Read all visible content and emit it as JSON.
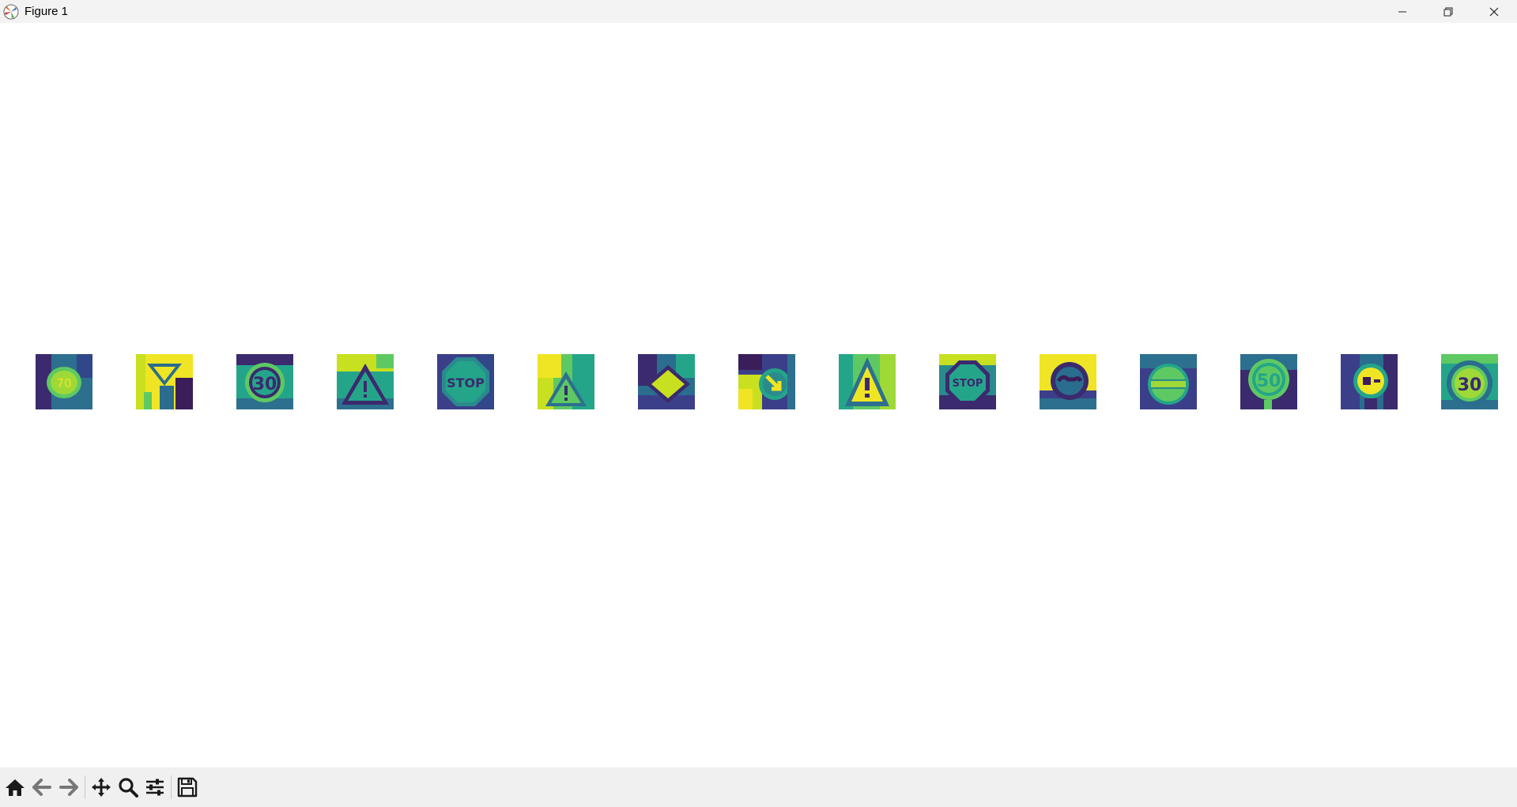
{
  "window": {
    "title": "Figure 1",
    "controls": [
      "minimize",
      "maximize",
      "close"
    ]
  },
  "figure": {
    "colormap": "viridis",
    "images": [
      {
        "index": 1,
        "depicts": "speed-limit-70",
        "text": "70"
      },
      {
        "index": 2,
        "depicts": "yield",
        "text": ""
      },
      {
        "index": 3,
        "depicts": "speed-limit-30",
        "text": "30"
      },
      {
        "index": 4,
        "depicts": "general-caution",
        "text": ""
      },
      {
        "index": 5,
        "depicts": "stop",
        "text": "STOP"
      },
      {
        "index": 6,
        "depicts": "general-caution",
        "text": ""
      },
      {
        "index": 7,
        "depicts": "priority-road",
        "text": ""
      },
      {
        "index": 8,
        "depicts": "keep-right",
        "text": ""
      },
      {
        "index": 9,
        "depicts": "general-caution",
        "text": ""
      },
      {
        "index": 10,
        "depicts": "stop",
        "text": "STOP"
      },
      {
        "index": 11,
        "depicts": "no-passing",
        "text": ""
      },
      {
        "index": 12,
        "depicts": "no-entry",
        "text": ""
      },
      {
        "index": 13,
        "depicts": "speed-limit-50",
        "text": "50"
      },
      {
        "index": 14,
        "depicts": "no-passing-trucks",
        "text": ""
      },
      {
        "index": 15,
        "depicts": "speed-limit-30",
        "text": "30"
      }
    ]
  },
  "toolbar": {
    "buttons": [
      "home-icon",
      "back-arrow-icon",
      "forward-arrow-icon",
      "pan-icon",
      "zoom-icon",
      "configure-subplots-icon",
      "save-icon"
    ]
  },
  "colors": {
    "dark": "#3b1d5a",
    "mid": "#2a8a8c",
    "teal": "#24a58a",
    "green": "#5ec962",
    "yellow": "#f0e524",
    "titlebar": "#f3f3f3",
    "toolbar": "#f0f0f0"
  }
}
